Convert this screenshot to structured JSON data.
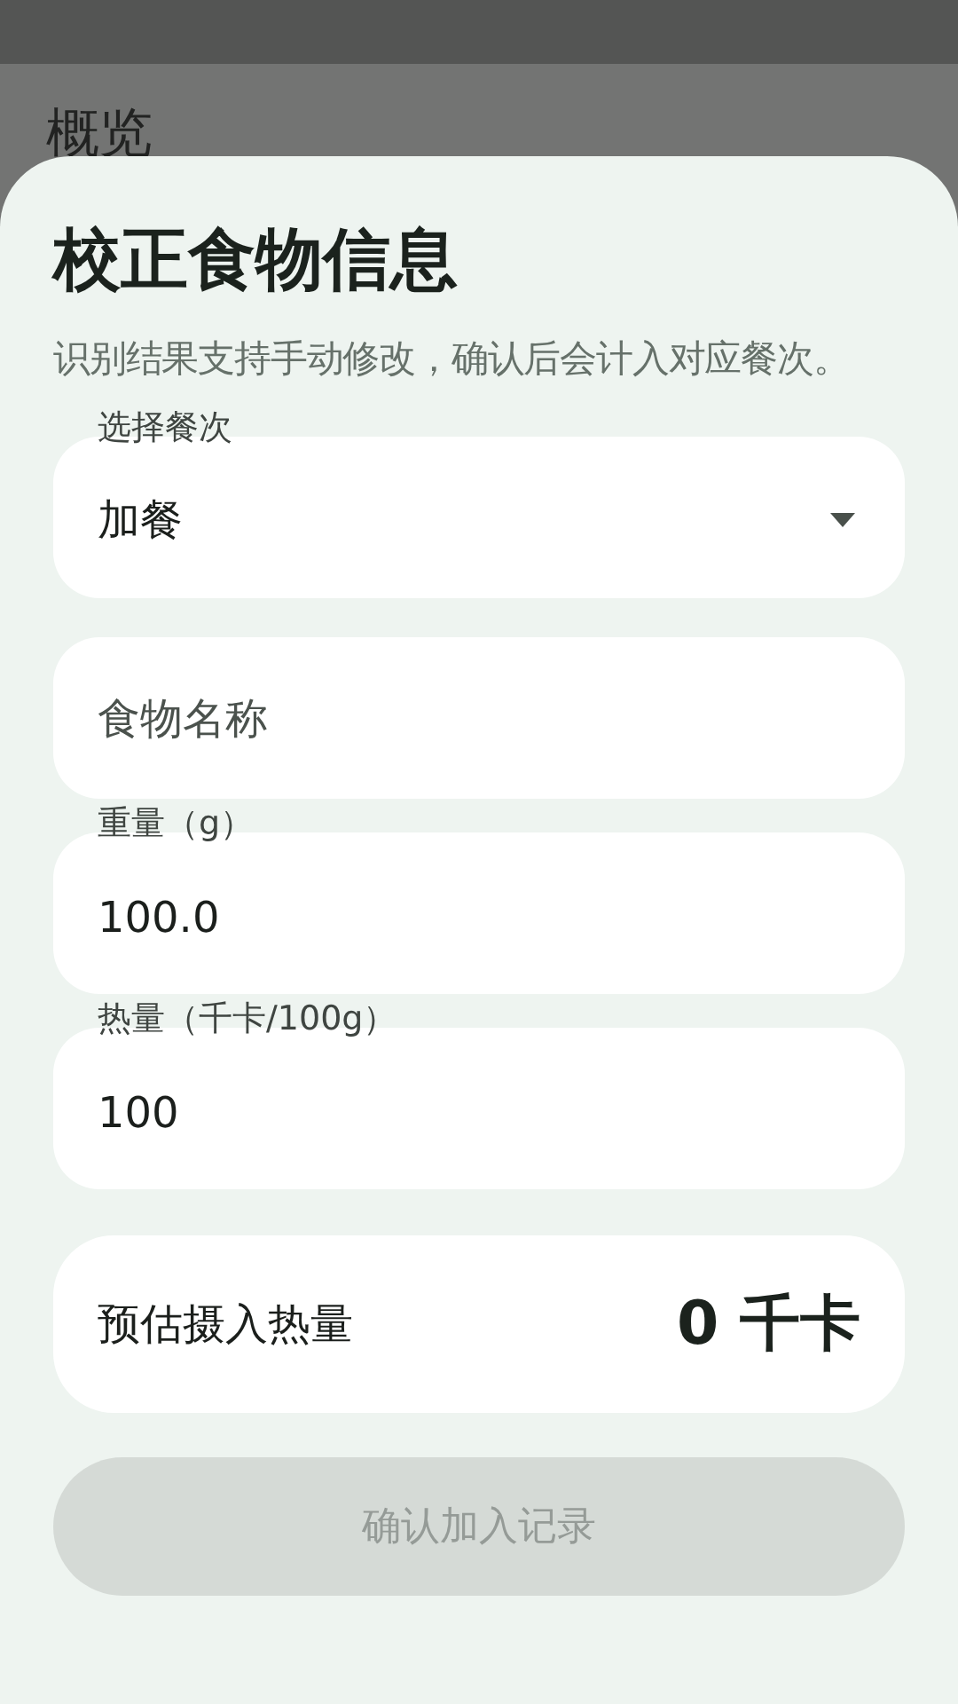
{
  "background_page": {
    "title": "概览"
  },
  "sheet": {
    "title": "校正食物信息",
    "subtitle": "识别结果支持手动修改，确认后会计入对应餐次。",
    "fields": [
      {
        "kind": "select",
        "label": "选择餐次",
        "value": "加餐"
      },
      {
        "kind": "text",
        "placeholder": "食物名称"
      },
      {
        "kind": "text",
        "label": "重量（g）",
        "value": "100.0"
      },
      {
        "kind": "text",
        "label": "热量（千卡/100g）",
        "value": "100"
      }
    ],
    "estimate": {
      "label": "预估摄入热量",
      "value": "0 千卡"
    },
    "confirm_button": {
      "label": "确认加入记录",
      "disabled": true
    }
  }
}
